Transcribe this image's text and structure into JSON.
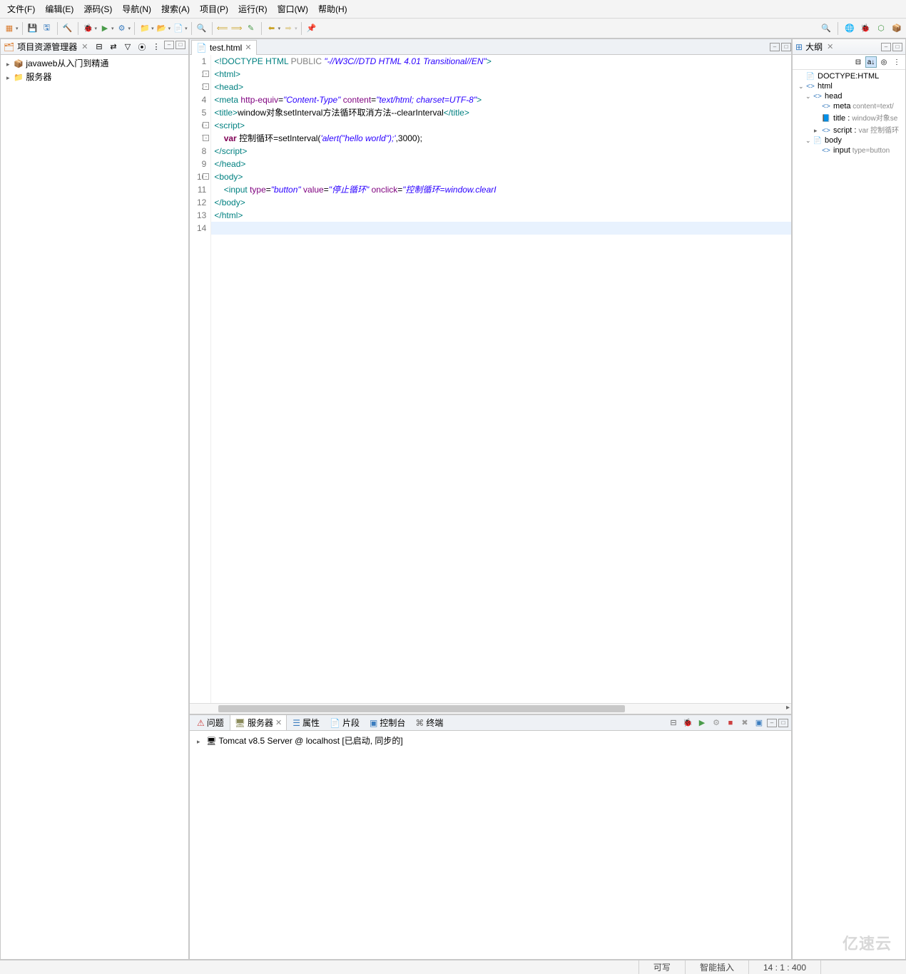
{
  "menus": [
    "文件(F)",
    "编辑(E)",
    "源码(S)",
    "导航(N)",
    "搜索(A)",
    "项目(P)",
    "运行(R)",
    "窗口(W)",
    "帮助(H)"
  ],
  "explorer": {
    "title": "项目资源管理器",
    "items": [
      {
        "icon": "📦",
        "label": "javaweb从入门到精通",
        "arrow": "▸",
        "color": "#c9a020"
      },
      {
        "icon": "📁",
        "label": "服务器",
        "arrow": "▸",
        "color": "#c9a020"
      }
    ]
  },
  "editor": {
    "tab": "test.html",
    "current_line": 14,
    "lines": [
      {
        "n": 1,
        "html": "<span class='doctype-kw'>&lt;!DOCTYPE</span> <span class='doctype-kw'>HTML</span> <span class='doctype-pub'>PUBLIC</span> <span class='str'>\"-//W3C//DTD HTML 4.01 Transitional//EN\"</span><span class='doctype-kw'>&gt;</span>"
      },
      {
        "n": 2,
        "fold": "-",
        "html": "<span class='tag'>&lt;html&gt;</span>"
      },
      {
        "n": 3,
        "fold": "-",
        "html": "<span class='tag'>&lt;head&gt;</span>"
      },
      {
        "n": 4,
        "html": "<span class='tag'>&lt;meta</span> <span class='attr'>http-equiv</span>=<span class='str'>\"Content-Type\"</span> <span class='attr'>content</span>=<span class='str'>\"text/html; charset=UTF-8\"</span><span class='tag'>&gt;</span>"
      },
      {
        "n": 5,
        "html": "<span class='tag'>&lt;title&gt;</span>window对象setInterval方法循环取消方法--clearInterval<span class='tag'>&lt;/title&gt;</span>"
      },
      {
        "n": 6,
        "fold": "-",
        "html": "<span class='tag'>&lt;script&gt;</span>"
      },
      {
        "n": 7,
        "fold": "-",
        "html": "    <span class='kw'>var</span> 控制循环=setInterval(<span class='str'>'alert(\"hello world\");'</span>,3000);"
      },
      {
        "n": 8,
        "html": "<span class='tag'>&lt;/script&gt;</span>"
      },
      {
        "n": 9,
        "html": "<span class='tag'>&lt;/head&gt;</span>"
      },
      {
        "n": 10,
        "fold": "-",
        "html": "<span class='tag'>&lt;body&gt;</span>"
      },
      {
        "n": 11,
        "html": "    <span class='tag'>&lt;input</span> <span class='attr'>type</span>=<span class='str'>\"button\"</span> <span class='attr'>value</span>=<span class='str'>\"停止循环\"</span> <span class='attr'>onclick</span>=<span class='str'>\"控制循环=window.clearI</span>"
      },
      {
        "n": 12,
        "html": "<span class='tag'>&lt;/body&gt;</span>"
      },
      {
        "n": 13,
        "html": "<span class='tag'>&lt;/html&gt;</span>"
      },
      {
        "n": 14,
        "html": ""
      }
    ]
  },
  "outline": {
    "title": "大纲",
    "items": [
      {
        "ind": 0,
        "arrow": "",
        "icon": "📄",
        "label": "DOCTYPE:HTML",
        "iconColor": "#cc9030"
      },
      {
        "ind": 0,
        "arrow": "⌄",
        "icon": "<>",
        "label": "html",
        "iconColor": "#3b7dbf"
      },
      {
        "ind": 1,
        "arrow": "⌄",
        "icon": "<>",
        "label": "head",
        "iconColor": "#3b7dbf"
      },
      {
        "ind": 2,
        "arrow": "",
        "icon": "<>",
        "label": "meta",
        "attr": " content=text/",
        "iconColor": "#3b7dbf"
      },
      {
        "ind": 2,
        "arrow": "",
        "icon": "📘",
        "label": "title : ",
        "attr": "window对象se",
        "iconColor": "#3b7dbf"
      },
      {
        "ind": 2,
        "arrow": "▸",
        "icon": "<>",
        "label": "script : ",
        "attr": "var 控制循环",
        "iconColor": "#3b7dbf"
      },
      {
        "ind": 1,
        "arrow": "⌄",
        "icon": "📄",
        "label": "body",
        "iconColor": "#cc9030"
      },
      {
        "ind": 2,
        "arrow": "",
        "icon": "<>",
        "label": "input",
        "attr": " type=button",
        "iconColor": "#3b7dbf"
      }
    ]
  },
  "bottom": {
    "tabs": [
      {
        "icon": "⚠",
        "label": "问题",
        "color": "#cc4040"
      },
      {
        "icon": "🖥",
        "label": "服务器",
        "active": true,
        "close": true,
        "color": "#8a8a5a"
      },
      {
        "icon": "☰",
        "label": "属性",
        "color": "#3b7dbf"
      },
      {
        "icon": "📄",
        "label": "片段",
        "color": "#cc9030"
      },
      {
        "icon": "▣",
        "label": "控制台",
        "color": "#3b7dbf"
      },
      {
        "icon": "⌘",
        "label": "终端",
        "color": "#666"
      }
    ],
    "server": "Tomcat v8.5 Server @ localhost  [已启动, 同步的]"
  },
  "status": {
    "writable": "可写",
    "insert": "智能插入",
    "pos": "14 : 1 : 400"
  },
  "watermark": "亿速云"
}
